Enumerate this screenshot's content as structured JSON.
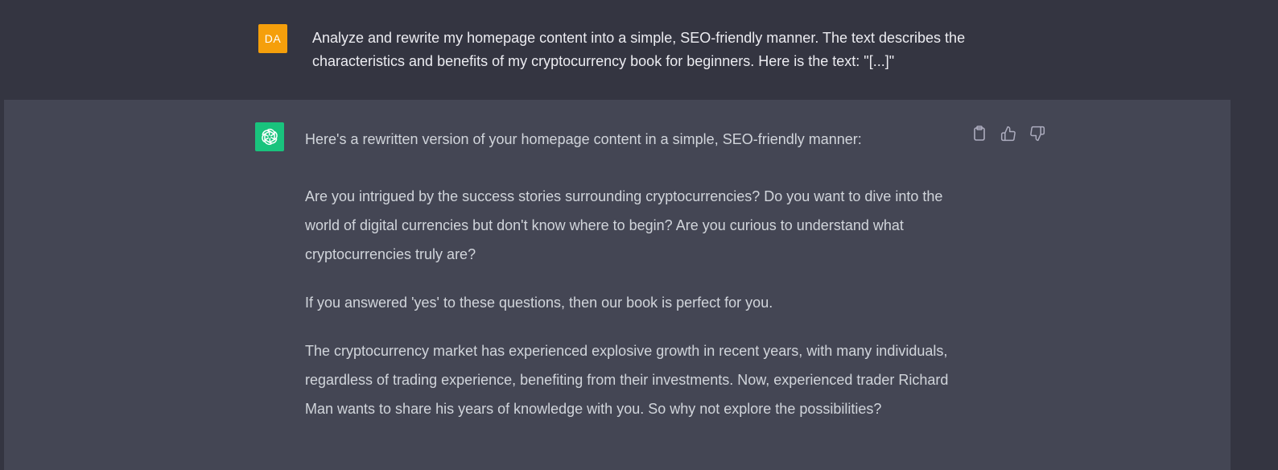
{
  "user_message": {
    "avatar_initials": "DA",
    "text": "Analyze and rewrite my homepage content into a simple, SEO-friendly manner. The text describes the characteristics and benefits of my cryptocurrency book for beginners. Here is the text: \"[...]\""
  },
  "assistant_message": {
    "avatar_icon": "openai-logo-icon",
    "paragraphs": [
      "Here's a rewritten version of your homepage content in a simple, SEO-friendly manner:",
      "Are you intrigued by the success stories surrounding cryptocurrencies? Do you want to dive into the world of digital currencies but don't know where to begin? Are you curious to understand what cryptocurrencies truly are?",
      "If you answered 'yes' to these questions, then our book is perfect for you.",
      "The cryptocurrency market has experienced explosive growth in recent years, with many individuals, regardless of trading experience, benefiting from their investments. Now, experienced trader Richard Man wants to share his years of knowledge with you. So why not explore the possibilities?"
    ],
    "actions": [
      {
        "icon": "clipboard-icon"
      },
      {
        "icon": "thumbs-up-icon"
      },
      {
        "icon": "thumbs-down-icon"
      }
    ]
  },
  "colors": {
    "background": "#343541",
    "assistant_background": "#444654",
    "user_avatar": "#f59f0b",
    "bot_avatar": "#19c37d",
    "user_text": "#ececf1",
    "assistant_text": "#d1d5db",
    "icon": "#acacbe"
  }
}
